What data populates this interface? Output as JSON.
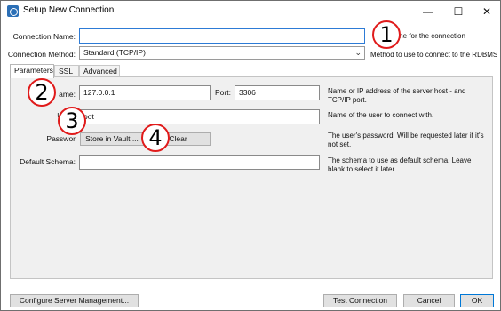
{
  "window": {
    "title": "Setup New Connection",
    "minimize_glyph": "—",
    "maximize_glyph": "☐",
    "close_glyph": "✕"
  },
  "form": {
    "connection_name_label": "Connection Name:",
    "connection_name_value": "",
    "connection_name_help": "me for the connection",
    "connection_method_label": "Connection Method:",
    "connection_method_value": "Standard (TCP/IP)",
    "connection_method_help": "Method to use to connect to the RDBMS"
  },
  "tabs": [
    {
      "label": "Parameters",
      "selected": true
    },
    {
      "label": "SSL",
      "selected": false
    },
    {
      "label": "Advanced",
      "selected": false
    }
  ],
  "parameters": {
    "hostname_label": "ame:",
    "hostname_value": "127.0.0.1",
    "port_label": "Port:",
    "port_value": "3306",
    "hostname_help_1": "Name or IP address of the server host - and",
    "hostname_help_2": "TCP/IP port.",
    "username_label": "Userr",
    "username_value": "oot",
    "username_help": "Name of the user to connect with.",
    "password_label": "Passwor",
    "store_in_vault_label": "Store in Vault ...",
    "clear_label": "Clear",
    "password_help_1": "The user's password. Will be requested later if it's",
    "password_help_2": "not set.",
    "default_schema_label": "Default Schema:",
    "default_schema_value": "",
    "default_schema_help_1": "The schema to use as default schema. Leave",
    "default_schema_help_2": "blank to select it later."
  },
  "footer": {
    "configure_label": "Configure Server Management...",
    "test_label": "Test Connection",
    "cancel_label": "Cancel",
    "ok_label": "OK"
  },
  "markers": [
    "1",
    "2",
    "3",
    "4"
  ],
  "colors": {
    "marker_border": "#e01b1b",
    "focus_border": "#2d7bd6",
    "panel_bg": "#f0f0f0"
  }
}
